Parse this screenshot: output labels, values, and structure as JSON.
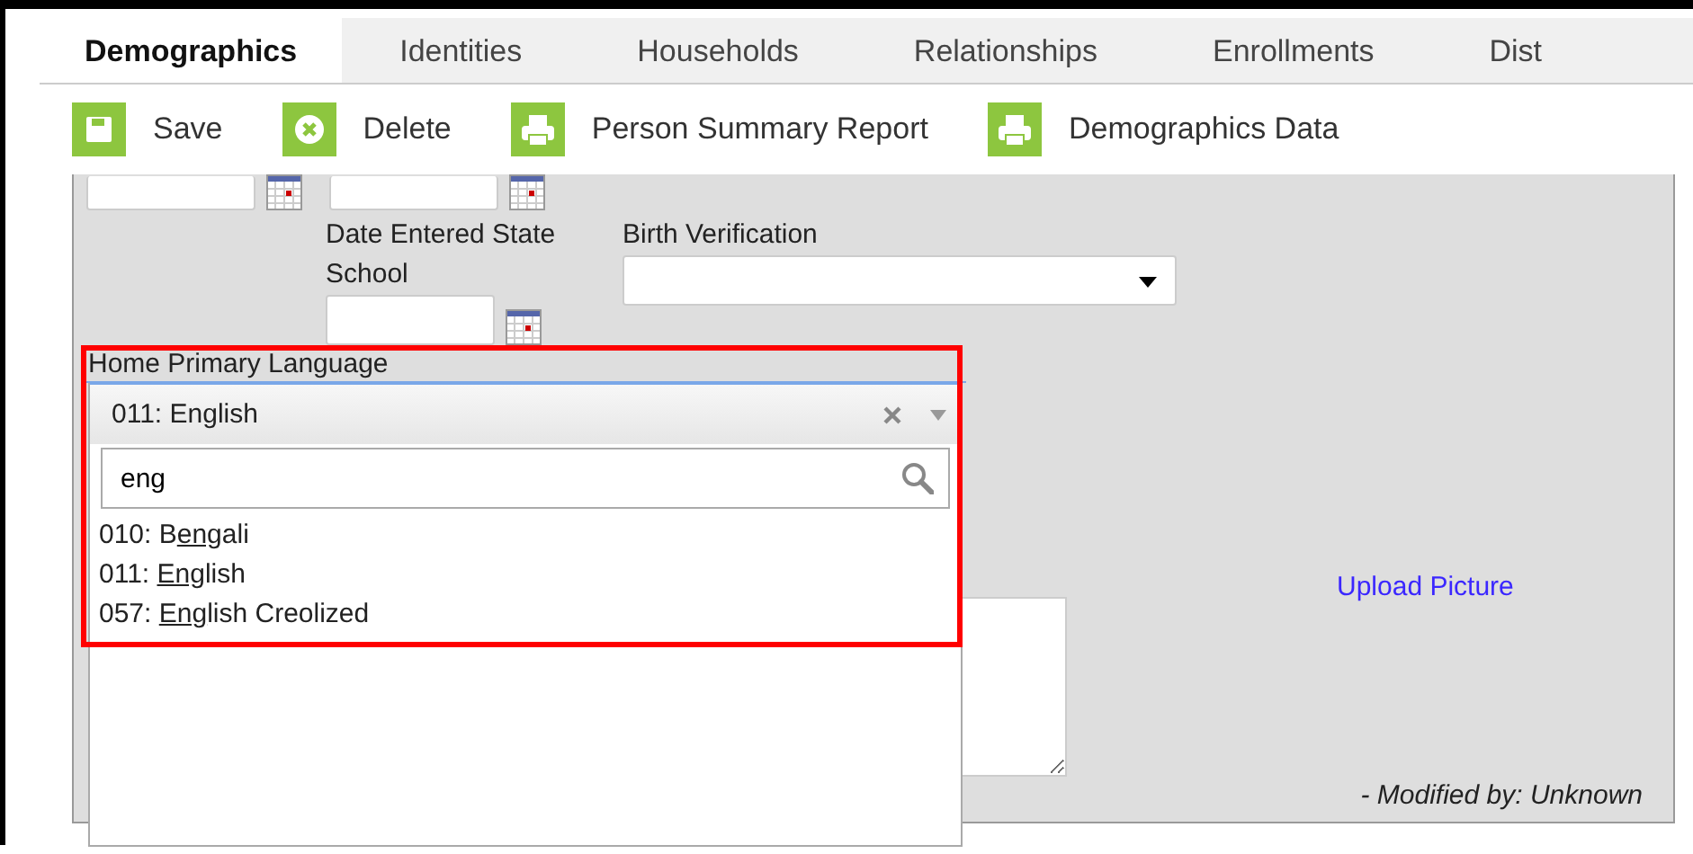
{
  "tabs": [
    {
      "label": "Demographics",
      "selected": true
    },
    {
      "label": "Identities",
      "selected": false
    },
    {
      "label": "Households",
      "selected": false
    },
    {
      "label": "Relationships",
      "selected": false
    },
    {
      "label": "Enrollments",
      "selected": false
    },
    {
      "label": "Dist",
      "selected": false
    }
  ],
  "toolbar": [
    {
      "label": "Save",
      "kind": "save"
    },
    {
      "label": "Delete",
      "kind": "delete"
    },
    {
      "label": "Person Summary Report",
      "kind": "print"
    },
    {
      "label": "Demographics Data",
      "kind": "print"
    }
  ],
  "form": {
    "date_entered_state_school": {
      "label": "Date Entered State School"
    },
    "birth_verification": {
      "label": "Birth Verification"
    },
    "home_primary_language": {
      "label": "Home Primary Language",
      "value": "011: English",
      "search": "eng",
      "expanded": true,
      "options": [
        {
          "before": "010: B",
          "match": "eng",
          "after": "ali"
        },
        {
          "before": "011: ",
          "match": "Eng",
          "after": "lish"
        },
        {
          "before": "057: ",
          "match": "Eng",
          "after": "lish Creolized"
        }
      ]
    },
    "upload_picture": "Upload Picture",
    "modified_by": "- Modified by: Unknown"
  }
}
